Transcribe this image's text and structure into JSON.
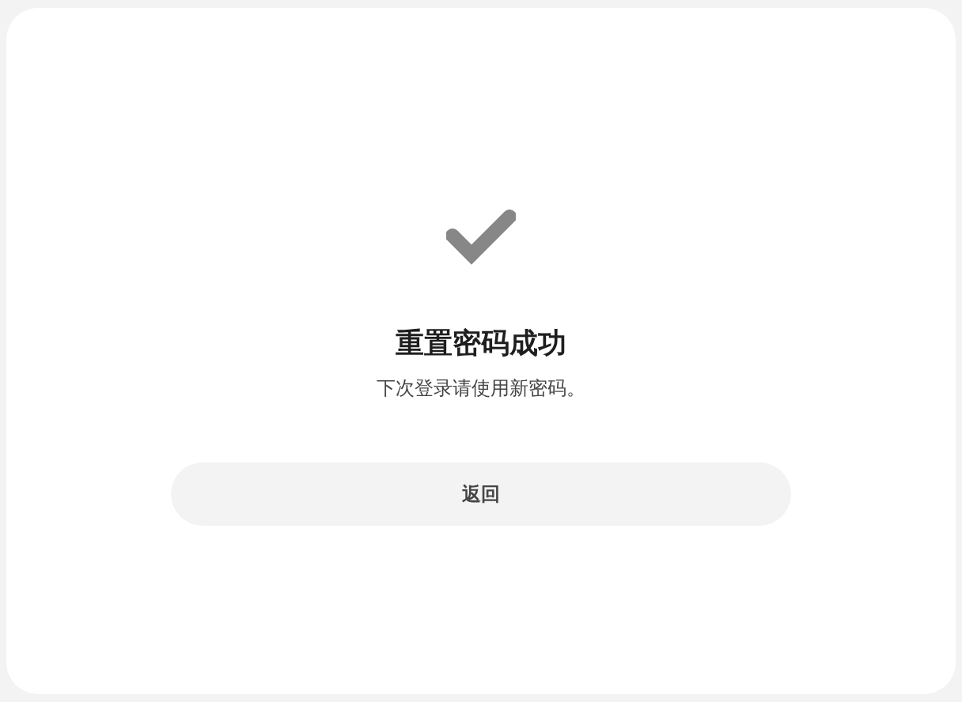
{
  "title": "重置密码成功",
  "message": "下次登录请使用新密码。",
  "button": {
    "label": "返回"
  }
}
